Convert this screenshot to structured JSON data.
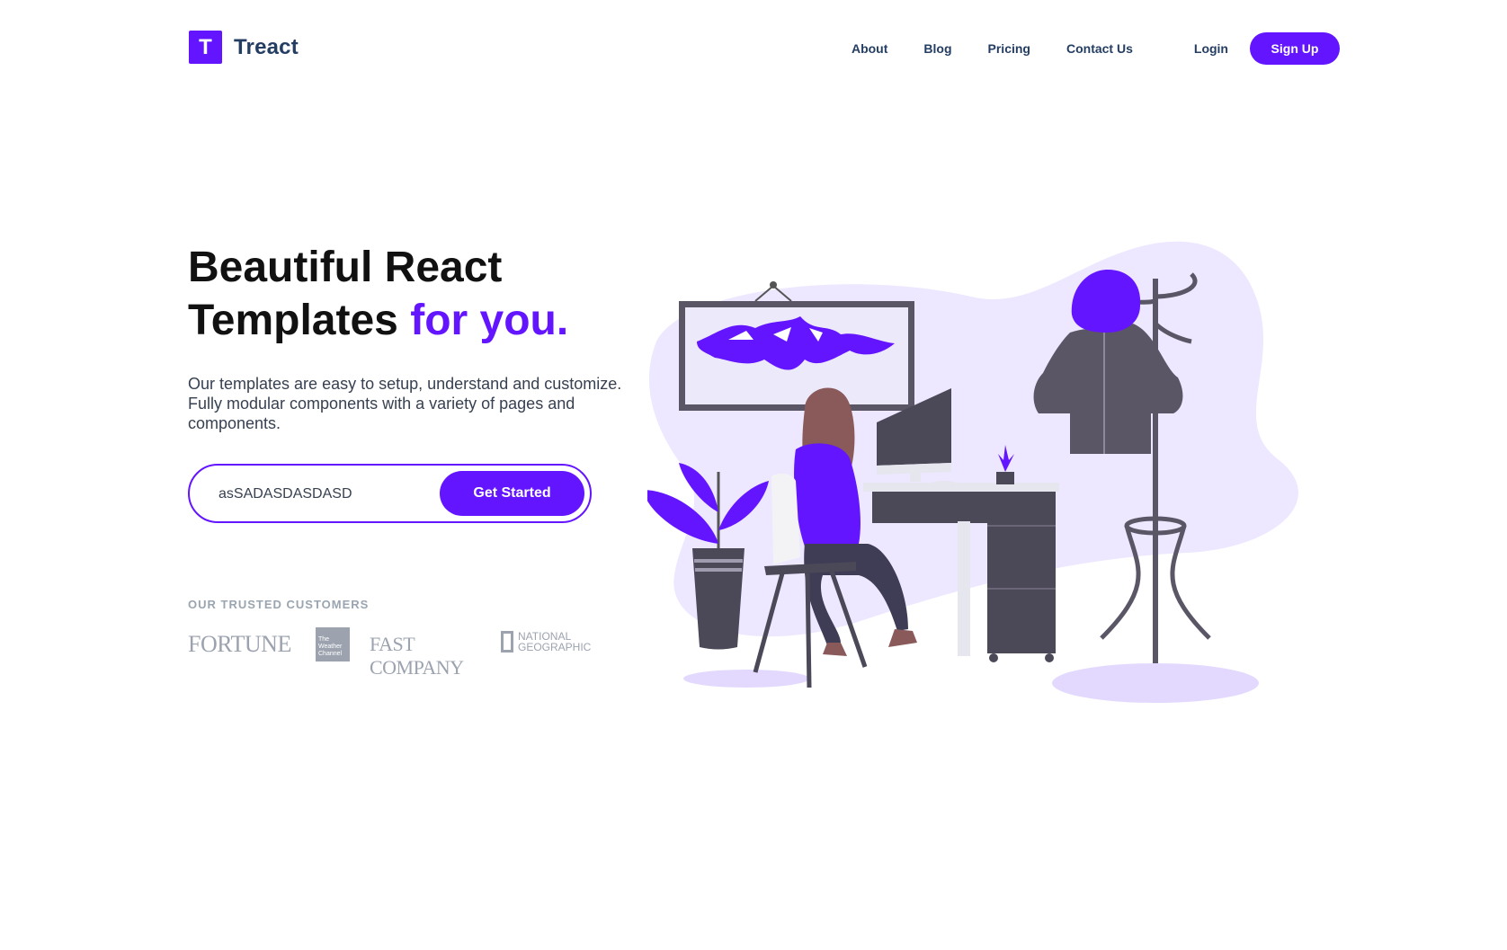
{
  "brand": {
    "mark": "T",
    "name": "Treact"
  },
  "nav": {
    "links": [
      "About",
      "Blog",
      "Pricing",
      "Contact Us"
    ],
    "login": "Login",
    "signup": "Sign Up"
  },
  "hero": {
    "headline_line1": "Beautiful React",
    "headline_line2": "Templates",
    "headline_accent": "for you.",
    "description": "Our templates are easy to setup, understand and customize. Fully modular components with a variety of pages and components.",
    "email_value": "asSADASDASDASD",
    "cta": "Get Started"
  },
  "customers": {
    "label": "OUR TRUSTED CUSTOMERS",
    "logos": {
      "fortune": "FORTUNE",
      "weather": "The Weather Channel",
      "fastcompany": "FAST COMPANY",
      "natgeo_line1": "NATIONAL",
      "natgeo_line2": "GEOGRAPHIC"
    }
  },
  "colors": {
    "primary": "#6415ff",
    "text_dark": "#243e63",
    "muted": "#9ca3af",
    "blob": "#ece5ff"
  }
}
